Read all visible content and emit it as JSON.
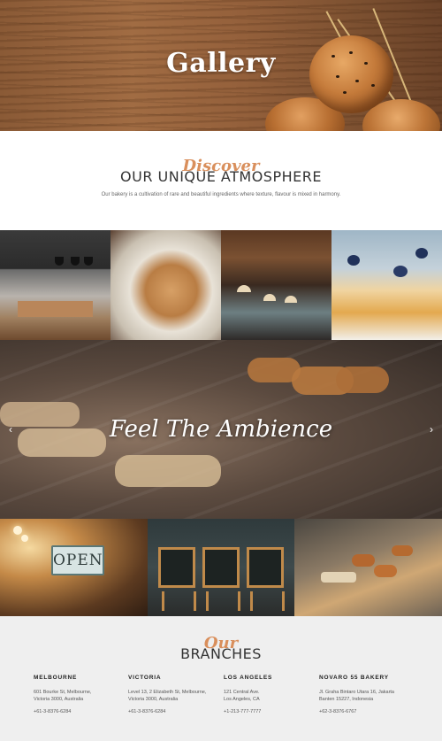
{
  "hero": {
    "title": "Gallery"
  },
  "discover": {
    "script": "Discover",
    "heading": "OUR UNIQUE ATMOSPHERE",
    "text": "Our bakery is a cultivation of rare and beautiful ingredients where texture, flavour is mixed in harmony."
  },
  "ambience": {
    "title": "Feel The Ambience",
    "prev_icon": "chevron-left-icon",
    "next_icon": "chevron-right-icon"
  },
  "gallery": {
    "open_sign": "OPEN"
  },
  "branches": {
    "script": "Our",
    "heading": "BRANCHES",
    "items": [
      {
        "city": "MELBOURNE",
        "address_line1": "601 Bourke St, Melbourne,",
        "address_line2": "Victoria 3000, Australia",
        "phone": "+61-3-8376-6284"
      },
      {
        "city": "VICTORIA",
        "address_line1": "Level 13, 2 Elizabeth St, Melbourne,",
        "address_line2": "Victoria 3000, Australia",
        "phone": "+61-3-8376-6284"
      },
      {
        "city": "LOS ANGELES",
        "address_line1": "121 Central Ave.",
        "address_line2": "Los Angeles, CA",
        "phone": "+1-213-777-7777"
      },
      {
        "city": "NOVARO 55 BAKERY",
        "address_line1": "Jl. Graha Bintaro Utara 16, Jakarta",
        "address_line2": "Banten 15227, Indonesia",
        "phone": "+62-3-8376-6767"
      }
    ]
  },
  "colors": {
    "accent": "#d98f5c",
    "branches_bg": "#efefef",
    "heading": "#333333"
  }
}
